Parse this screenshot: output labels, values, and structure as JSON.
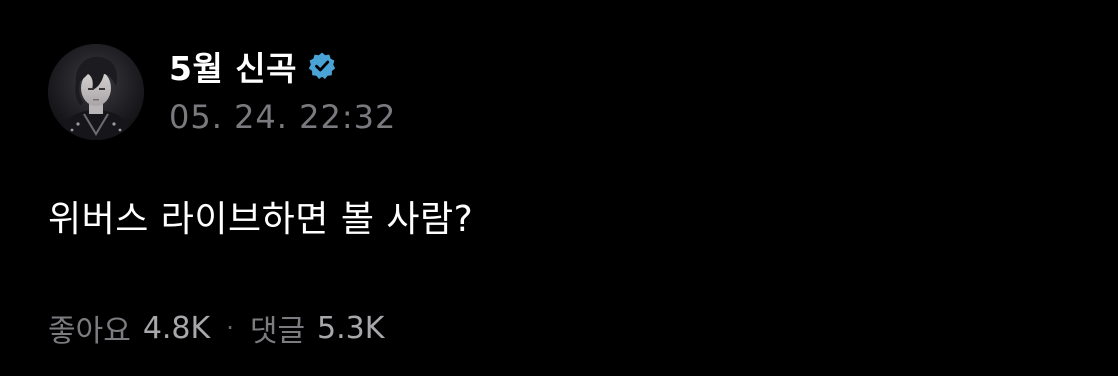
{
  "post": {
    "author": {
      "display_name": "5월 신곡",
      "verified": true,
      "verified_icon": "verified-badge-icon",
      "verified_color": "#4aa3d6"
    },
    "timestamp": "05. 24. 22:32",
    "body": "위버스 라이브하면 볼 사람?",
    "stats": {
      "likes_label": "좋아요",
      "likes_value": "4.8K",
      "separator": "·",
      "comments_label": "댓글",
      "comments_value": "5.3K"
    }
  },
  "colors": {
    "background": "#000000",
    "text_primary": "#ffffff",
    "text_secondary": "#7a7a7e"
  }
}
